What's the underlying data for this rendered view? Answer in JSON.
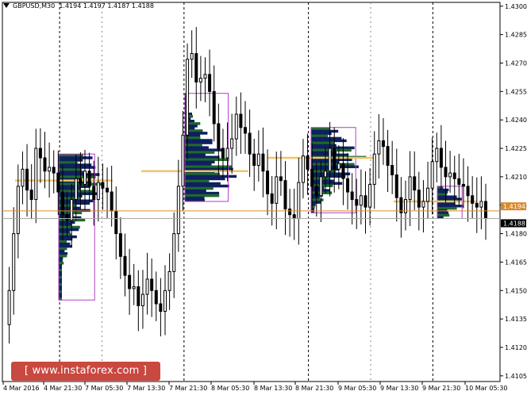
{
  "header": {
    "symbol_tf": "GBPUSD,M30",
    "ohlc": "1.4194 1.4197 1.4187 1.4188"
  },
  "watermark": "[  www.instaforex.com  ]",
  "colors": {
    "candle": "#000000",
    "profile_dark": "#0f2060",
    "profile_green": "#1f6b2a",
    "box": "#b040c8",
    "poc": "#f2c46a",
    "level_line": "#d98a2b",
    "grid": "#000000",
    "price_box": "#000000"
  },
  "chart_data": {
    "type": "candlestick",
    "symbol": "GBPUSD",
    "timeframe": "M30",
    "ylim": [
      1.4102,
      1.4302
    ],
    "y_ticks": [
      "1.4300",
      "1.4285",
      "1.4270",
      "1.4255",
      "1.4240",
      "1.4225",
      "1.4210",
      "1.4195",
      "1.4180",
      "1.4165",
      "1.4150",
      "1.4135",
      "1.4120",
      "1.4105"
    ],
    "x_ticks": [
      "4 Mar 2016",
      "4 Mar 21:30",
      "7 Mar 05:30",
      "7 Mar 13:30",
      "7 Mar 21:30",
      "8 Mar 05:30",
      "8 Mar 13:30",
      "8 Mar 21:30",
      "9 Mar 05:30",
      "9 Mar 13:30",
      "9 Mar 21:30",
      "10 Mar 05:30"
    ],
    "current_price_labels": [
      "1.4194",
      "1.4188"
    ],
    "horizontal_level": 1.4192,
    "session_separators_x_fraction": [
      0.115,
      0.365,
      0.615,
      0.865
    ],
    "close_path": [
      1.4132,
      1.415,
      1.418,
      1.4205,
      1.4214,
      1.4203,
      1.4198,
      1.4225,
      1.422,
      1.4213,
      1.4215,
      1.4212,
      1.4202,
      1.419,
      1.4187,
      1.4198,
      1.4209,
      1.4206,
      1.4213,
      1.4205,
      1.4198,
      1.4207,
      1.4204,
      1.4202,
      1.4192,
      1.418,
      1.4168,
      1.4158,
      1.4151,
      1.4152,
      1.4142,
      1.4148,
      1.4156,
      1.415,
      1.4143,
      1.4139,
      1.415,
      1.416,
      1.418,
      1.4205,
      1.4232,
      1.4272,
      1.4275,
      1.426,
      1.4262,
      1.4264,
      1.4255,
      1.4238,
      1.4225,
      1.422,
      1.4225,
      1.423,
      1.4243,
      1.4236,
      1.4233,
      1.4222,
      1.4216,
      1.4222,
      1.4213,
      1.4201,
      1.4196,
      1.421,
      1.4208,
      1.4193,
      1.419,
      1.4188,
      1.4207,
      1.4221,
      1.4214,
      1.4205,
      1.42,
      1.421,
      1.4213,
      1.4225,
      1.4214,
      1.4217,
      1.4209,
      1.4202,
      1.4198,
      1.4195,
      1.42,
      1.4194,
      1.4206,
      1.4222,
      1.4229,
      1.4226,
      1.4216,
      1.4211,
      1.4199,
      1.4191,
      1.4198,
      1.421,
      1.4203,
      1.4194,
      1.4197,
      1.4204,
      1.4218,
      1.4225,
      1.4215,
      1.421,
      1.4212,
      1.4209,
      1.4206,
      1.4205,
      1.42,
      1.4196,
      1.4194,
      1.4197,
      1.4188
    ],
    "volume_profiles": [
      {
        "start": "4 Mar 21:30",
        "top": 1.4222,
        "bottom": 1.4145,
        "poc": 1.4208
      },
      {
        "start": "7 Mar 21:30",
        "top": 1.4254,
        "bottom": 1.4197,
        "poc": 1.4213
      },
      {
        "start": "8 Mar 21:30",
        "top": 1.4236,
        "bottom": 1.4191,
        "poc": 1.422
      },
      {
        "start": "9 Mar 21:30",
        "top": 1.4205,
        "bottom": 1.4188,
        "poc": 1.4197
      }
    ]
  }
}
